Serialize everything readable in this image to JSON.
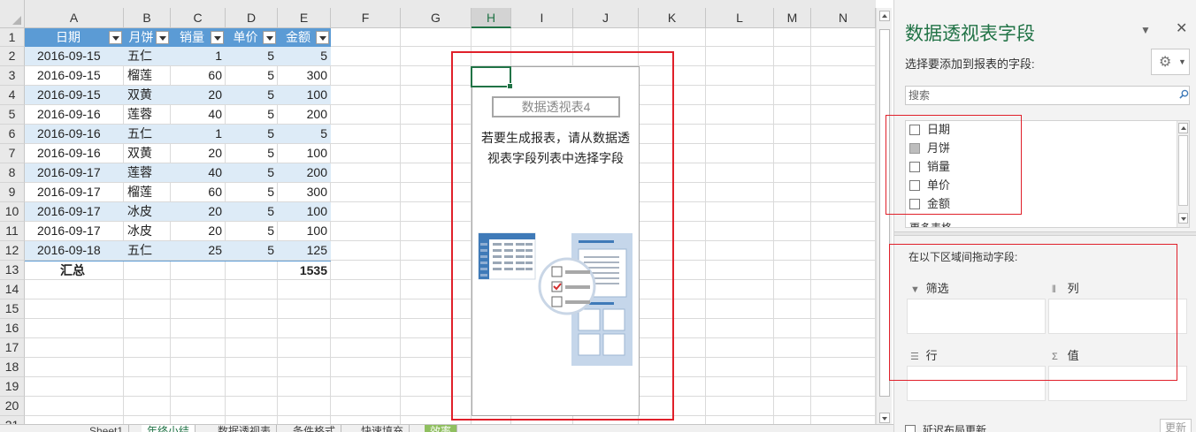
{
  "columns": [
    "A",
    "B",
    "C",
    "D",
    "E",
    "F",
    "G",
    "H",
    "I",
    "J",
    "K",
    "L",
    "M",
    "N"
  ],
  "selected_column": "H",
  "rows": [
    "1",
    "2",
    "3",
    "4",
    "5",
    "6",
    "7",
    "8",
    "9",
    "10",
    "11",
    "12",
    "13",
    "14",
    "15",
    "16",
    "17",
    "18",
    "19",
    "20",
    "21"
  ],
  "table": {
    "headers": [
      "日期",
      "月饼",
      "销量",
      "单价",
      "金额"
    ],
    "rows": [
      [
        "2016-09-15",
        "五仁",
        "1",
        "5",
        "5"
      ],
      [
        "2016-09-15",
        "榴莲",
        "60",
        "5",
        "300"
      ],
      [
        "2016-09-15",
        "双黄",
        "20",
        "5",
        "100"
      ],
      [
        "2016-09-16",
        "莲蓉",
        "40",
        "5",
        "200"
      ],
      [
        "2016-09-16",
        "五仁",
        "1",
        "5",
        "5"
      ],
      [
        "2016-09-16",
        "双黄",
        "20",
        "5",
        "100"
      ],
      [
        "2016-09-17",
        "莲蓉",
        "40",
        "5",
        "200"
      ],
      [
        "2016-09-17",
        "榴莲",
        "60",
        "5",
        "300"
      ],
      [
        "2016-09-17",
        "冰皮",
        "20",
        "5",
        "100"
      ],
      [
        "2016-09-17",
        "冰皮",
        "20",
        "5",
        "100"
      ],
      [
        "2016-09-18",
        "五仁",
        "25",
        "5",
        "125"
      ]
    ],
    "total_label": "汇总",
    "total_value": "1535"
  },
  "pivot": {
    "name": "数据透视表4",
    "hint_line1": "若要生成报表，请从数据透",
    "hint_line2": "视表字段列表中选择字段"
  },
  "sheet_tabs": [
    "Sheet1",
    "年终小结",
    "数据透视表",
    "条件格式",
    "快速填充",
    "效率"
  ],
  "active_tab": "年终小结",
  "pane": {
    "title": "数据透视表字段",
    "choose_label": "选择要添加到报表的字段:",
    "search_placeholder": "搜索",
    "fields": [
      {
        "label": "日期",
        "checked": false
      },
      {
        "label": "月饼",
        "checked": false
      },
      {
        "label": "销量",
        "checked": false
      },
      {
        "label": "单价",
        "checked": false
      },
      {
        "label": "金额",
        "checked": false
      }
    ],
    "more_tables": "更多表格...",
    "drag_label": "在以下区域间拖动字段:",
    "zones": {
      "filter": "筛选",
      "columns": "列",
      "rows": "行",
      "values": "值"
    },
    "defer_label": "延迟布局更新",
    "update_label": "更新"
  },
  "colors": {
    "accent": "#217346",
    "table_header": "#5b9bd5",
    "band": "#ddebf7",
    "annotation": "#e0202a"
  }
}
